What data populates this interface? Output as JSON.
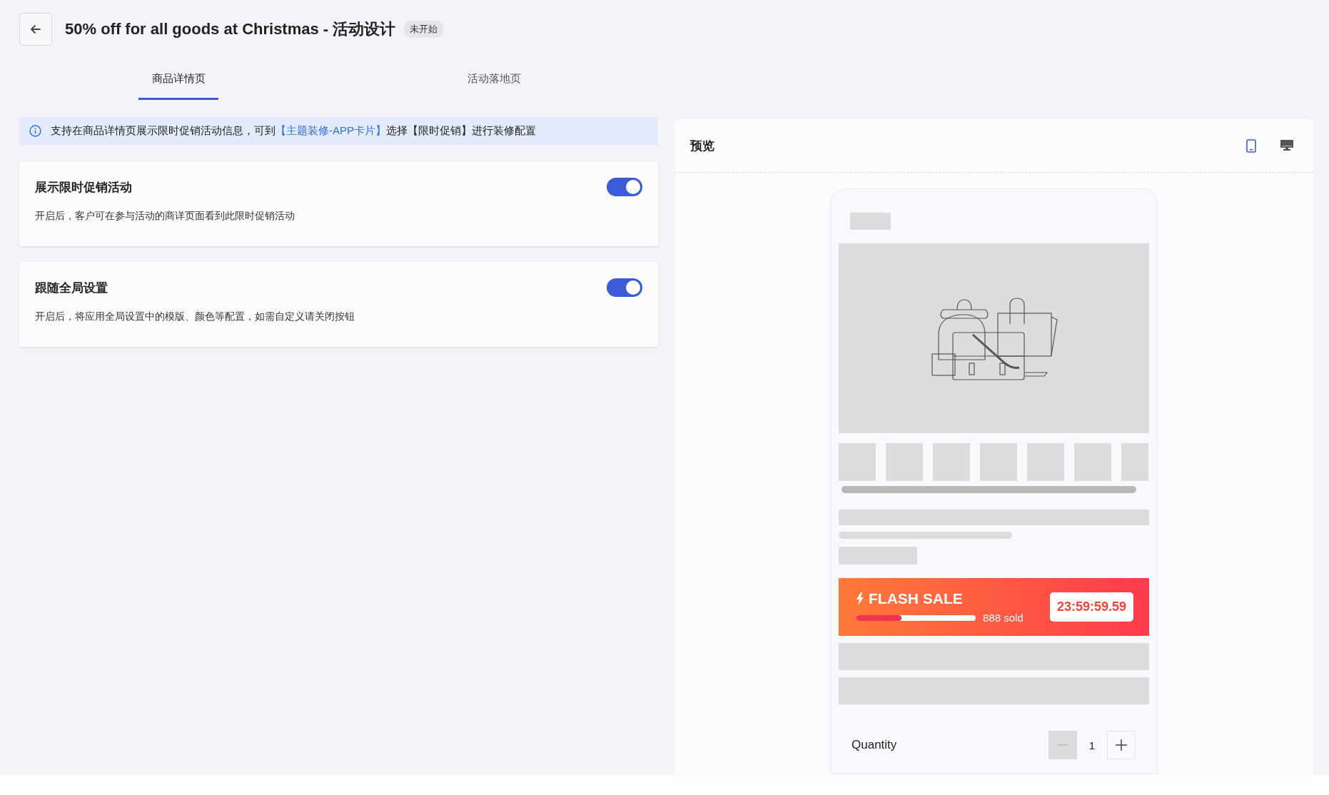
{
  "header": {
    "title": "50% off for all goods at Christmas - 活动设计",
    "status_badge": "未开始"
  },
  "tabs": [
    {
      "label": "商品详情页",
      "selected": true
    },
    {
      "label": "活动落地页",
      "selected": false
    }
  ],
  "notice": {
    "before": "支持在商品详情页展示限时促销活动信息，可到",
    "link": "【主题装修-APP卡片】",
    "after": "选择【限时促销】进行装修配置"
  },
  "settings": [
    {
      "title": "展示限时促销活动",
      "description": "开启后，客户可在参与活动的商详页面看到此限时促销活动",
      "on": true
    },
    {
      "title": "跟随全局设置",
      "description": "开启后，将应用全局设置中的模版、颜色等配置，如需自定义请关闭按钮",
      "on": true
    }
  ],
  "preview": {
    "title": "预览",
    "devices": [
      {
        "kind": "mobile",
        "selected": true
      },
      {
        "kind": "desktop",
        "selected": false
      }
    ],
    "flash_sale": {
      "label": "FLASH SALE",
      "level": 0.38,
      "sold": "888 sold",
      "countdown": "23:59:59.59"
    },
    "quantity": {
      "label": "Quantity",
      "value": "1"
    }
  }
}
